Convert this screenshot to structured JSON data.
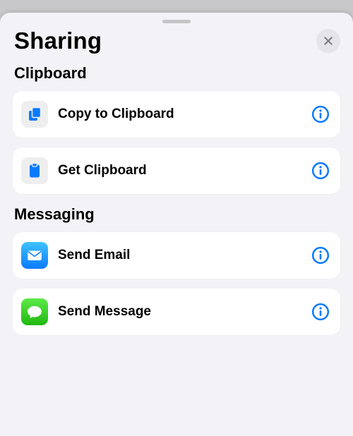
{
  "title": "Sharing",
  "colors": {
    "accent": "#0a7aff",
    "sheetBg": "#f2f2f7"
  },
  "sections": [
    {
      "header": "Clipboard",
      "items": [
        {
          "label": "Copy to Clipboard",
          "icon": "copy-icon"
        },
        {
          "label": "Get Clipboard",
          "icon": "clipboard-icon"
        }
      ]
    },
    {
      "header": "Messaging",
      "items": [
        {
          "label": "Send Email",
          "icon": "mail-app-icon"
        },
        {
          "label": "Send Message",
          "icon": "messages-app-icon"
        }
      ]
    }
  ]
}
